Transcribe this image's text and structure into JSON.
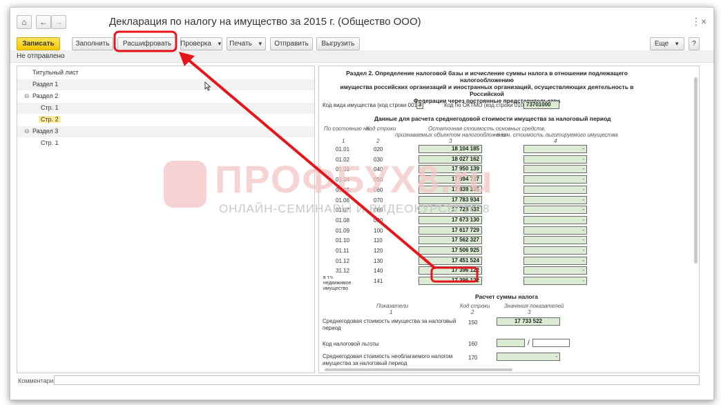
{
  "window": {
    "title": "Декларация по налогу на имущество за 2015 г. (Общество ООО)",
    "home_glyph": "⌂",
    "back_glyph": "←",
    "forward_glyph": "→",
    "more_glyph": "⋮",
    "close_glyph": "×"
  },
  "toolbar": {
    "save": "Записать",
    "fill": "Заполнить",
    "decode": "Расшифровать",
    "check": "Проверка",
    "print": "Печать",
    "send": "Отправить",
    "upload": "Выгрузить",
    "more": "Еще",
    "help": "?",
    "caret": "▼"
  },
  "status": "Не отправлено",
  "tree": {
    "items": [
      {
        "label": "Титульный лист"
      },
      {
        "label": "Раздел 1"
      },
      {
        "label": "Раздел 2",
        "toggle": "⊖"
      },
      {
        "label": "Стр. 1"
      },
      {
        "label": "Стр. 2"
      },
      {
        "label": "Раздел 3",
        "toggle": "⊖"
      },
      {
        "label": "Стр. 1"
      }
    ]
  },
  "form": {
    "section_title_lines": [
      "Раздел 2. Определение налоговой базы и исчисление суммы налога в отношении подлежащего налогообложению",
      "имущества российских организаций и иностранных организаций, осуществляющих деятельность в Российской",
      "Федерации через постоянные представительства"
    ],
    "property_code_label": "Код вида имущества (код строки 001)",
    "property_code_value": "3",
    "oktmo_label": "Код по ОКТМО (код строки 010)",
    "oktmo_value": "73701000",
    "avg_data_title": "Данные для расчета среднегодовой стоимости имущества за налоговый период",
    "col_date": "По состоянию на:",
    "col_code": "Код строки",
    "col_residual_1": "Остаточная стоимость основных средств,",
    "col_residual_2": "признаваемых объектом налогообложения",
    "col_benefit": "в т.ч. стоимость льготируемого имущества",
    "col_num_1": "1",
    "col_num_2": "2",
    "col_num_3": "3",
    "col_num_4": "4",
    "rows": [
      {
        "date": "01.01",
        "code": "020",
        "value": "18 104 185",
        "benefit": "-"
      },
      {
        "date": "01.02",
        "code": "030",
        "value": "18 027 162",
        "benefit": "-"
      },
      {
        "date": "01.03",
        "code": "040",
        "value": "17 950 139",
        "benefit": "-"
      },
      {
        "date": "01.04",
        "code": "050",
        "value": "17 894 737",
        "benefit": "-"
      },
      {
        "date": "01.05",
        "code": "060",
        "value": "17 839 335",
        "benefit": "-"
      },
      {
        "date": "01.06",
        "code": "070",
        "value": "17 783 934",
        "benefit": "-"
      },
      {
        "date": "01.07",
        "code": "080",
        "value": "17 728 532",
        "benefit": "-"
      },
      {
        "date": "01.08",
        "code": "090",
        "value": "17 673 130",
        "benefit": "-"
      },
      {
        "date": "01.09",
        "code": "100",
        "value": "17 617 729",
        "benefit": "-"
      },
      {
        "date": "01.10",
        "code": "110",
        "value": "17 562 327",
        "benefit": "-"
      },
      {
        "date": "01.11",
        "code": "120",
        "value": "17 506 925",
        "benefit": "-"
      },
      {
        "date": "01.12",
        "code": "130",
        "value": "17 451 524",
        "benefit": "-"
      },
      {
        "date": "31.12",
        "code": "140",
        "value": "17 396 122",
        "benefit": "-"
      },
      {
        "date": "в т.ч. недвижимое имущество",
        "code": "141",
        "value": "17 396 122",
        "benefit": "-"
      }
    ],
    "calc_title": "Расчет суммы налога",
    "calc_col_ind": "Показатели",
    "calc_col_code": "Код строки",
    "calc_col_val": "Значения показателей",
    "calc_num_1": "1",
    "calc_num_2": "2",
    "calc_num_3": "3",
    "calc_rows": [
      {
        "label_1": "Среднегодовая стоимость имущества за налоговый",
        "label_2": "период",
        "code": "150",
        "value": "17 733 522"
      },
      {
        "label_1": "Код налоговой льготы",
        "label_2": "",
        "code": "160",
        "value": "",
        "sep": "/"
      },
      {
        "label_1": "Среднегодовая стоимость необлагаемого налогом",
        "label_2": "имущества за налоговый период",
        "code": "170",
        "value": "-"
      }
    ]
  },
  "comment_label": "Комментарий:",
  "watermark": {
    "text": "ПРОФБУХ8.ru",
    "subtext": "ОНЛАЙН-СЕМИНАРЫ И ВИДЕОКУРСЫ 1С:8"
  },
  "colors": {
    "annotation": "#e8141c",
    "save_button": "#f5c800",
    "form_cell": "#dcecd4"
  }
}
